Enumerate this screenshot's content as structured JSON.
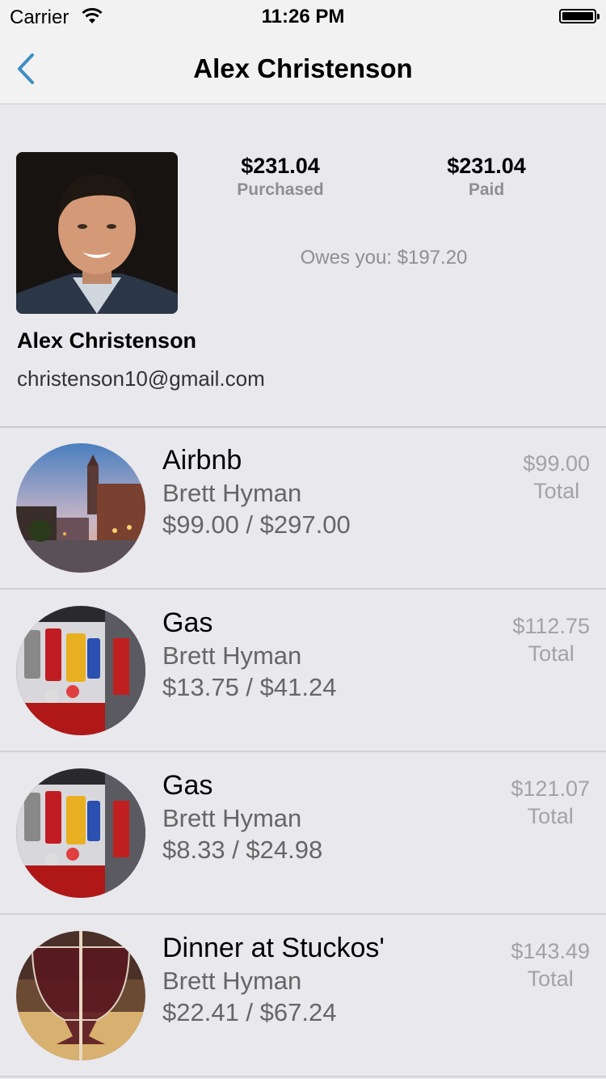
{
  "status_bar": {
    "carrier": "Carrier",
    "time": "11:26 PM"
  },
  "nav": {
    "title": "Alex Christenson",
    "back_icon": "chevron-left-icon",
    "accent": "#3d8fc4"
  },
  "profile": {
    "name": "Alex Christenson",
    "email": "christenson10@gmail.com",
    "purchased_amount": "$231.04",
    "purchased_label": "Purchased",
    "paid_amount": "$231.04",
    "paid_label": "Paid",
    "owes": "Owes you: $197.20"
  },
  "transactions": [
    {
      "title": "Airbnb",
      "person": "Brett Hyman",
      "amounts": "$99.00 / $297.00",
      "total": "$99.00",
      "total_label": "Total",
      "image": "city-street-photo"
    },
    {
      "title": "Gas",
      "person": "Brett Hyman",
      "amounts": "$13.75 / $41.24",
      "total": "$112.75",
      "total_label": "Total",
      "image": "gas-pump-photo"
    },
    {
      "title": "Gas",
      "person": "Brett Hyman",
      "amounts": "$8.33 / $24.98",
      "total": "$121.07",
      "total_label": "Total",
      "image": "gas-pump-photo"
    },
    {
      "title": "Dinner at Stuckos'",
      "person": "Brett Hyman",
      "amounts": "$22.41 / $67.24",
      "total": "$143.49",
      "total_label": "Total",
      "image": "beer-glass-photo"
    }
  ]
}
